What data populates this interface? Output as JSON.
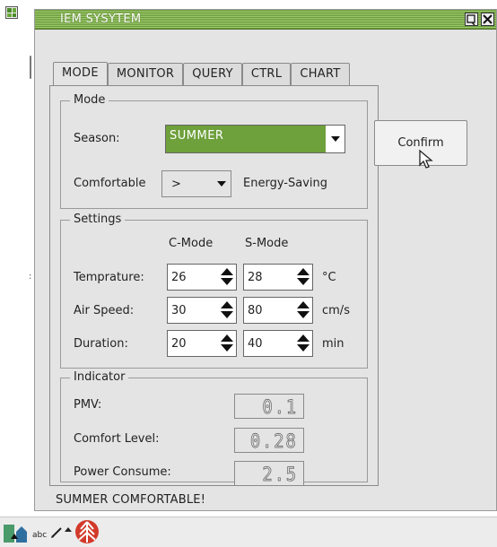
{
  "window": {
    "title": "IEM SYSYTEM"
  },
  "tabs": [
    "MODE",
    "MONITOR",
    "QUERY",
    "CTRL",
    "CHART"
  ],
  "mode_group": {
    "title": "Mode",
    "season_label": "Season:",
    "season_value": "SUMMER",
    "comfortable_label": "Comfortable",
    "comparison_value": ">",
    "energy_label": "Energy-Saving"
  },
  "settings_group": {
    "title": "Settings",
    "col_c_mode": "C-Mode",
    "col_s_mode": "S-Mode",
    "rows": [
      {
        "label": "Temprature:",
        "c_value": "26",
        "s_value": "28",
        "unit": "°C"
      },
      {
        "label": "Air Speed:",
        "c_value": "30",
        "s_value": "80",
        "unit": "cm/s"
      },
      {
        "label": "Duration:",
        "c_value": "20",
        "s_value": "40",
        "unit": "min"
      }
    ]
  },
  "indicator_group": {
    "title": "Indicator",
    "rows": [
      {
        "label": "PMV:",
        "value": "0.1"
      },
      {
        "label": "Comfort Level:",
        "value": "0.28"
      },
      {
        "label": "Power Consume:",
        "value": "2.5"
      }
    ]
  },
  "confirm_label": "Confirm",
  "status_text": "SUMMER COMFORTABLE!",
  "taskbar": {
    "abc_label": "abc"
  },
  "colors": {
    "title_bar": "#8cbc5c",
    "season_highlight": "#6ea03c"
  }
}
